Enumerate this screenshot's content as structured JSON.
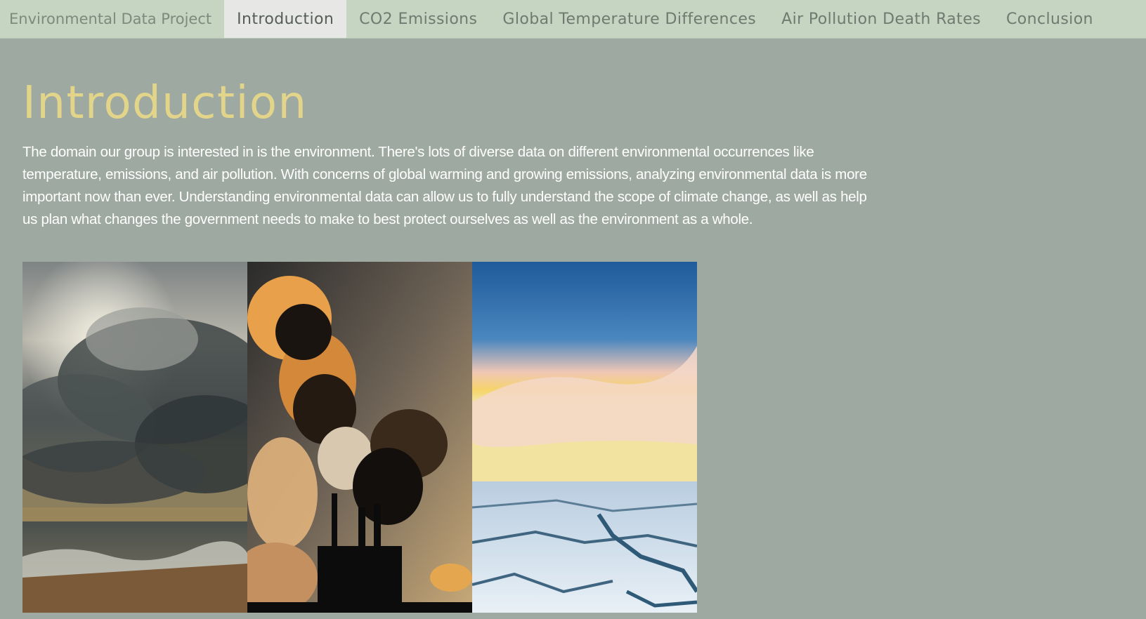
{
  "nav": {
    "brand": "Environmental Data Project",
    "items": [
      {
        "label": "Introduction",
        "active": true
      },
      {
        "label": "CO2 Emissions",
        "active": false
      },
      {
        "label": "Global Temperature Differences",
        "active": false
      },
      {
        "label": "Air Pollution Death Rates",
        "active": false
      },
      {
        "label": "Conclusion",
        "active": false
      }
    ]
  },
  "main": {
    "title": "Introduction",
    "paragraph": "The domain our group is interested in is the environment. There's lots of diverse data on different environmental occurrences like temperature, emissions, and air pollution. With concerns of global warming and growing emissions, analyzing environmental data is more important now than ever. Understanding environmental data can allow us to fully understand the scope of climate change, as well as help us plan what changes the government needs to make to best protect ourselves as well as the environment as a whole."
  },
  "images": [
    {
      "subject": "storm-clouds-over-sea"
    },
    {
      "subject": "factory-smokestack-smoke"
    },
    {
      "subject": "sea-ice-sunset"
    }
  ],
  "colors": {
    "navbar_bg": "#c5d5c1",
    "active_tab_bg": "#e7e8e6",
    "page_bg": "#9ea9a1",
    "title": "#e2d58a",
    "body_text": "#ffffff"
  }
}
